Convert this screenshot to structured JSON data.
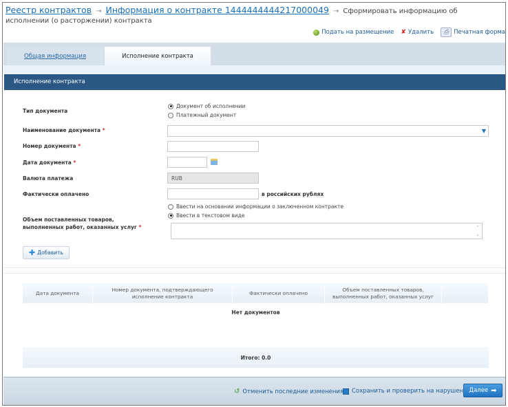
{
  "breadcrumb": {
    "item1": "Реестр контрактов",
    "item2": "Информация о контракте 1444444444217000049",
    "current": "Сформировать информацию об исполнении (о расторжении) контракта",
    "separator": "→"
  },
  "actions": {
    "publish": "Подать на размещение",
    "delete": "Удалить",
    "print": "Печатная форма"
  },
  "tabs": [
    {
      "label": "Общая информация"
    },
    {
      "label": "Исполнение контракта"
    }
  ],
  "section_title": "Исполнение контракта",
  "form": {
    "doc_type": {
      "label": "Тип документа",
      "options": [
        "Документ об исполнении",
        "Платежный документ"
      ],
      "selected": 0
    },
    "doc_name": {
      "label": "Наименование документа",
      "value": ""
    },
    "doc_number": {
      "label": "Номер документа",
      "value": ""
    },
    "doc_date": {
      "label": "Дата документа",
      "value": ""
    },
    "currency": {
      "label": "Валюта платежа",
      "value": "RUB"
    },
    "paid": {
      "label": "Фактически оплачено",
      "value": "",
      "suffix": "в российских рублях"
    },
    "volume": {
      "label": "Объем поставленных товаров, выполненных работ, оказанных услуг",
      "options": [
        "Ввести на основании информации о заключенном контракте",
        "Ввести в текстовом виде"
      ],
      "selected": 1,
      "value": ""
    },
    "required_mark": "*",
    "add_button": "Добавить"
  },
  "table": {
    "headers": [
      "Дата документа",
      "Номер документа, подтверждающего исполнение контракта",
      "Фактически оплачено",
      "Объем поставленных товаров, выполненных работ, оказанных услуг",
      ""
    ],
    "empty": "Нет документов",
    "total": "Итого: 0.0"
  },
  "footer": {
    "undo": "Отменить последние изменения",
    "save": "Сохранить и проверить на нарушения",
    "next": "Далее"
  },
  "colors": {
    "header": "#2b5784",
    "link": "#1a6fb5",
    "button": "#1f72c0"
  }
}
